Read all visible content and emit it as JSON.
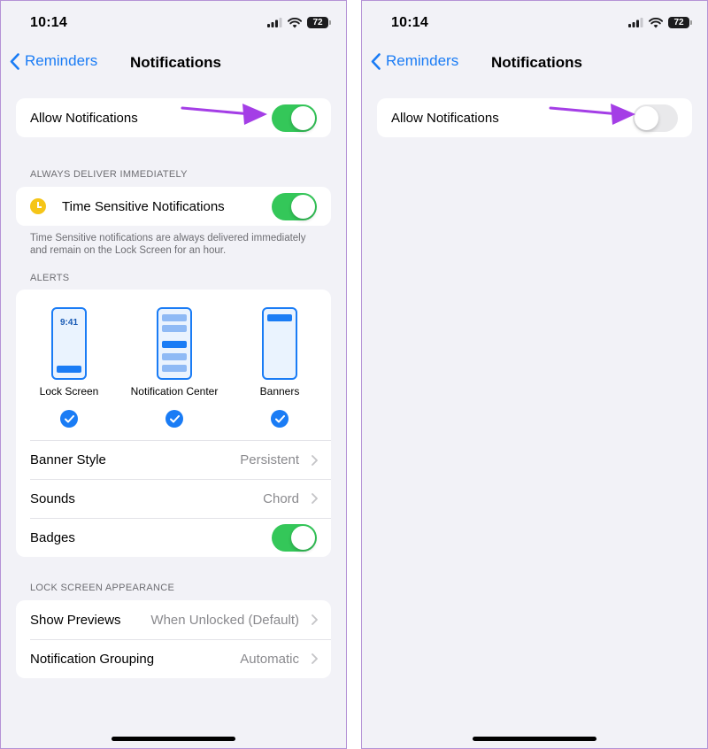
{
  "left": {
    "status_time": "10:14",
    "battery": "72",
    "back_label": "Reminders",
    "title": "Notifications",
    "allow_notifications": {
      "label": "Allow Notifications",
      "on": true
    },
    "always_deliver_header": "ALWAYS DELIVER IMMEDIATELY",
    "time_sensitive": {
      "label": "Time Sensitive Notifications",
      "on": true
    },
    "time_sensitive_footnote": "Time Sensitive notifications are always delivered immediately and remain on the Lock Screen for an hour.",
    "alerts_header": "ALERTS",
    "alert_options": [
      {
        "label": "Lock Screen",
        "mini_time": "9:41",
        "checked": true
      },
      {
        "label": "Notification Center",
        "checked": true
      },
      {
        "label": "Banners",
        "checked": true
      }
    ],
    "banner_style": {
      "label": "Banner Style",
      "value": "Persistent"
    },
    "sounds": {
      "label": "Sounds",
      "value": "Chord"
    },
    "badges": {
      "label": "Badges",
      "on": true
    },
    "lock_screen_header": "LOCK SCREEN APPEARANCE",
    "show_previews": {
      "label": "Show Previews",
      "value": "When Unlocked (Default)"
    },
    "notification_grouping": {
      "label": "Notification Grouping",
      "value": "Automatic"
    }
  },
  "right": {
    "status_time": "10:14",
    "battery": "72",
    "back_label": "Reminders",
    "title": "Notifications",
    "allow_notifications": {
      "label": "Allow Notifications",
      "on": false
    }
  },
  "colors": {
    "accent": "#1a7cf5",
    "toggle_on": "#34c759",
    "toggle_off": "#e9e9eb",
    "annotation_arrow": "#a43ee6",
    "background": "#f2f2f7"
  },
  "icons": [
    "back-chevron-icon",
    "signal-icon",
    "wifi-icon",
    "battery-icon",
    "clock-icon",
    "checkmark-icon",
    "chevron-right-icon",
    "annotation-arrow"
  ]
}
